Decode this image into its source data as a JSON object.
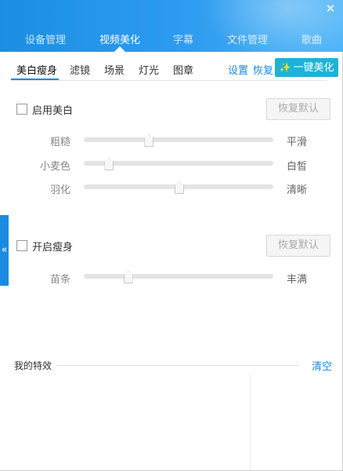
{
  "window": {
    "close_glyph": "✕",
    "main_tabs": [
      {
        "label": "设备管理",
        "active": false
      },
      {
        "label": "视频美化",
        "active": true
      },
      {
        "label": "字幕",
        "active": false
      },
      {
        "label": "文件管理",
        "active": false
      },
      {
        "label": "歌曲",
        "active": false
      }
    ],
    "accent_color": "#1a8be0"
  },
  "sub_tabs": [
    {
      "label": "美白瘦身",
      "active": true
    },
    {
      "label": "滤镜",
      "active": false
    },
    {
      "label": "场景",
      "active": false
    },
    {
      "label": "灯光",
      "active": false
    },
    {
      "label": "图章",
      "active": false
    }
  ],
  "toolbar": {
    "settings_label": "设置",
    "restore_label": "恢复",
    "one_click_label": "一键美化",
    "one_click_icon": "magic-wand-icon"
  },
  "whitening": {
    "enabled": false,
    "checkbox_label": "启用美白",
    "reset_label": "恢复默认",
    "sliders": [
      {
        "left": "粗糙",
        "right": "平滑",
        "value": 0.34
      },
      {
        "left": "小麦色",
        "right": "白皙",
        "value": 0.13
      },
      {
        "left": "羽化",
        "right": "清晰",
        "value": 0.5
      }
    ]
  },
  "slimming": {
    "enabled": false,
    "checkbox_label": "开启瘦身",
    "reset_label": "恢复默认",
    "sliders": [
      {
        "left": "苗条",
        "right": "丰满",
        "value": 0.23
      }
    ]
  },
  "side_handle": {
    "glyph": "«"
  },
  "effects": {
    "title": "我的特效",
    "clear_label": "清空"
  }
}
